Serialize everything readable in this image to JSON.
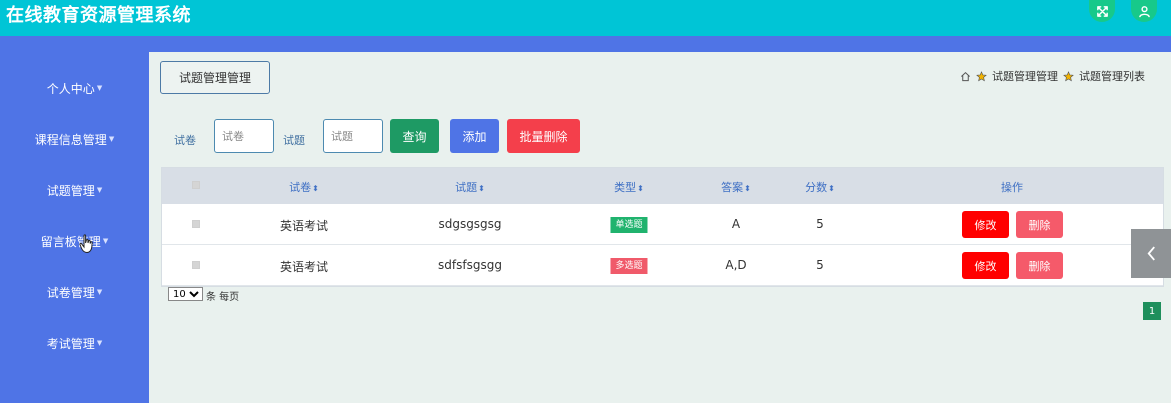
{
  "app": {
    "title": "在线教育资源管理系统"
  },
  "header": {
    "icons": [
      "expand-icon",
      "user-icon"
    ]
  },
  "colors": {
    "header": "#00c5d6",
    "sidebar": "#4f74e6",
    "search": "#1e9a64",
    "add": "#4f74e6",
    "batch_delete": "#f43f4b",
    "edit": "#ff0000",
    "delete": "#f55a6a",
    "single_tag": "#20b36e",
    "multi_tag": "#f05a6a"
  },
  "sidebar": {
    "items": [
      {
        "label": "个人中心"
      },
      {
        "label": "课程信息管理"
      },
      {
        "label": "试题管理"
      },
      {
        "label": "留言板管理"
      },
      {
        "label": "试卷管理"
      },
      {
        "label": "考试管理"
      }
    ]
  },
  "page": {
    "title": "试题管理管理",
    "breadcrumb": [
      "试题管理管理",
      "试题管理列表"
    ]
  },
  "filters": {
    "paper_label": "试卷",
    "paper_placeholder": "试卷",
    "question_label": "试题",
    "question_placeholder": "试题"
  },
  "buttons": {
    "search": "查询",
    "add": "添加",
    "batch_delete": "批量删除"
  },
  "table": {
    "columns": [
      "试卷",
      "试题",
      "类型",
      "答案",
      "分数",
      "操作"
    ],
    "rows": [
      {
        "paper": "英语考试",
        "question": "sdgsgsgsg",
        "type": "单选题",
        "answer": "A",
        "score": "5",
        "edit": "修改",
        "delete": "删除"
      },
      {
        "paper": "英语考试",
        "question": "sdfsfsgsgg",
        "type": "多选题",
        "answer": "A,D",
        "score": "5",
        "edit": "修改",
        "delete": "删除"
      }
    ]
  },
  "pagination": {
    "page_size": "10",
    "page_size_label": "条 每页",
    "current_page": "1"
  }
}
